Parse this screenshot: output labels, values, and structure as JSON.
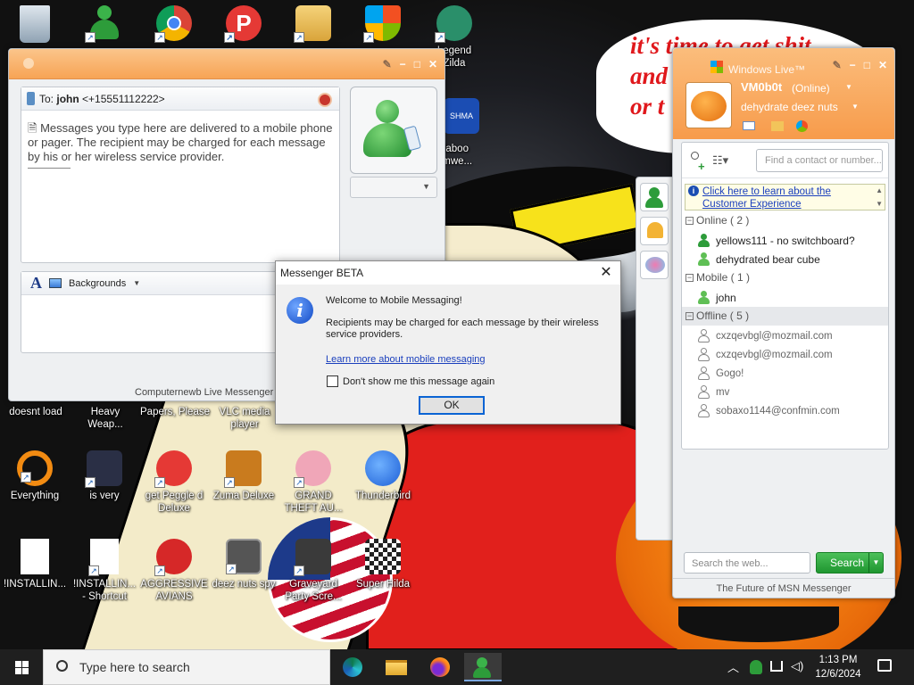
{
  "desktop": {
    "meme_text": [
      "it's time to get shit",
      "and",
      "or t"
    ],
    "icons": [
      {
        "key": "doesnt_load",
        "label": "doesnt load"
      },
      {
        "key": "heavy",
        "label": "Heavy\nWeap..."
      },
      {
        "key": "papers",
        "label": "Papers, Please"
      },
      {
        "key": "vlc",
        "label": "VLC media\nplayer"
      },
      {
        "key": "everything",
        "label": "Everything"
      },
      {
        "key": "isvery",
        "label": "is very"
      },
      {
        "key": "peggle",
        "label": "get Peggle d\nDeluxe"
      },
      {
        "key": "zuma",
        "label": "Zuma Deluxe"
      },
      {
        "key": "gta",
        "label": "GRAND\nTHEFT AU..."
      },
      {
        "key": "thunderbird",
        "label": "Thunderbird"
      },
      {
        "key": "installing",
        "label": "!INSTALLIN..."
      },
      {
        "key": "installing2",
        "label": "!INSTALLIN...\n- Shortcut"
      },
      {
        "key": "aggressive",
        "label": "AGGRESSIVE\nAVIANS"
      },
      {
        "key": "deeznuts",
        "label": "deez nuts spy"
      },
      {
        "key": "graveyard",
        "label": "Graveyard\nParty Scre..."
      },
      {
        "key": "hilda",
        "label": "Super Hilda"
      },
      {
        "key": "legend",
        "label": "Legend\nZilda"
      },
      {
        "key": "shma",
        "label": "SHMA"
      },
      {
        "key": "daboo",
        "label": "daboo\nomwe..."
      }
    ]
  },
  "chat": {
    "title_icons": [
      "paint-icon",
      "minimize",
      "maximize",
      "close"
    ],
    "to_label": "To:",
    "to_name": "john",
    "to_number": "<+15551112222>",
    "info_message": "Messages you type here are delivered to a mobile phone or pager. The recipient may be charged for each message by his or her wireless service provider.",
    "backgrounds_label": "Backgrounds",
    "status": "Computernewb Live Messenger d"
  },
  "dialog": {
    "title": "Messenger BETA",
    "close": "✕",
    "heading": "Welcome to Mobile Messaging!",
    "body": "Recipients may be charged for each message by their wireless service providers.",
    "link": "Learn more about mobile messaging",
    "checkbox_label": "Don't show me this message again",
    "ok": "OK"
  },
  "contacts": {
    "app_title": "Windows Live™",
    "display_name": "VM0b0t",
    "status": "(Online)",
    "personal_message": "dehydrate deez nuts",
    "find_placeholder": "Find a contact or number...",
    "info_text_1": "Click here to learn about the",
    "info_text_2": "Customer Experience",
    "groups": [
      {
        "name": "Online ( 2 )",
        "online": true,
        "contacts": [
          "yellows111 - no switchboard?",
          "dehydrated bear cube"
        ]
      },
      {
        "name": "Mobile ( 1 )",
        "online": true,
        "contacts": [
          "john"
        ]
      },
      {
        "name": "Offline ( 5 )",
        "online": false,
        "contacts": [
          "cxzqevbgl@mozmail.com",
          "cxzqevbgl@mozmail.com",
          "Gogo!",
          "mv",
          "sobaxo1144@confmin.com"
        ]
      }
    ],
    "web_search_placeholder": "Search the web...",
    "search_button": "Search",
    "footer": "The Future of MSN Messenger"
  },
  "taskbar": {
    "search_placeholder": "Type here to search",
    "time": "1:13 PM",
    "date": "12/6/2024"
  },
  "colors": {
    "msn_orange": "#f7a455",
    "msn_green": "#2d9c3a",
    "link_blue": "#1a3fbd"
  }
}
